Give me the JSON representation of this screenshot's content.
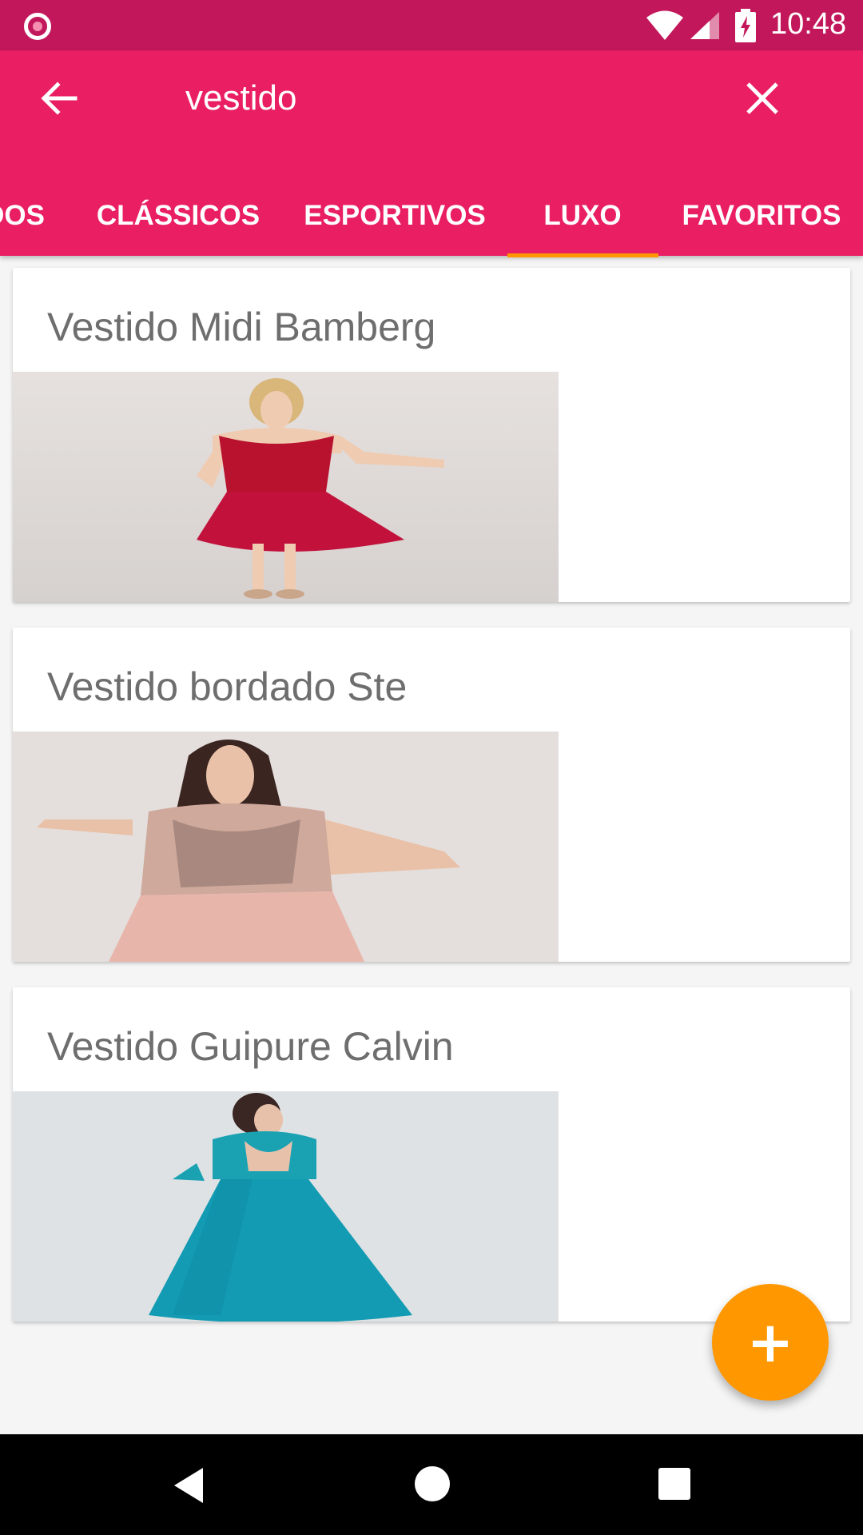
{
  "status_bar": {
    "time": "10:48",
    "icons": [
      "notification-dot-icon",
      "wifi-icon",
      "signal-icon",
      "battery-charging-icon"
    ]
  },
  "app_bar": {
    "search_query": "vestido",
    "back_icon": "arrow-back-icon",
    "clear_icon": "close-icon",
    "tabs": [
      {
        "label": "DOS",
        "visible_label": "OS"
      },
      {
        "label": "CLÁSSICOS"
      },
      {
        "label": "ESPORTIVOS"
      },
      {
        "label": "LUXO",
        "selected": true
      },
      {
        "label": "FAVORITOS"
      }
    ]
  },
  "cards": [
    {
      "title": "Vestido Midi Bamberg",
      "dress_color": "#c2123b"
    },
    {
      "title": "Vestido bordado Ste",
      "dress_color": "#e9b7ae"
    },
    {
      "title": "Vestido Guipure Calvin",
      "dress_color": "#139bb3"
    }
  ],
  "fab": {
    "icon": "plus-icon",
    "symbol": "+",
    "color": "#ff9800"
  },
  "nav_bar": {
    "icons": [
      "nav-back-icon",
      "nav-home-icon",
      "nav-recents-icon"
    ]
  },
  "colors": {
    "status_bar": "#c2185b",
    "app_bar": "#e91e63",
    "tab_indicator": "#ff9800",
    "card_title": "#6e6e6e"
  }
}
